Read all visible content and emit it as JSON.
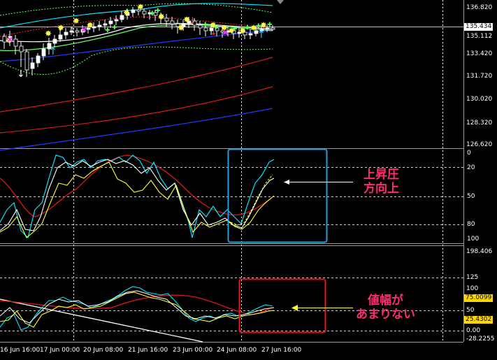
{
  "price_axis": {
    "ticks": [
      "136.820",
      "135.112",
      "133.420",
      "131.720",
      "130.020",
      "128.320",
      "126.620"
    ],
    "current": "135.434"
  },
  "osc1_axis": {
    "ticks": [
      "0",
      "20",
      "50",
      "80",
      "100"
    ]
  },
  "osc2_axis": {
    "ticks": [
      "198.406",
      "125",
      "100",
      "50",
      "0.00",
      "-28.2255"
    ],
    "box_upper": "75.0099",
    "box_lower": "25.4302"
  },
  "time_axis": [
    "16 Jun 16:00",
    "17 Jun 00:00",
    "20 Jun 08:00",
    "21 Jun 16:00",
    "23 Jun 00:00",
    "24 Jun 08:00",
    "27 Jun 16:00"
  ],
  "annotations": {
    "upper": [
      "上昇圧",
      "方向上"
    ],
    "lower": [
      "値幅が",
      "あまりない"
    ]
  },
  "colors": {
    "bg": "#000000",
    "grid": "#ffffff",
    "panel_border": "#aaaaaa",
    "upper_box": "#1fa0dc",
    "lower_box": "#e01818",
    "annotation": "#ff2d6e",
    "cyan": "#00e5ff",
    "yellow": "#ffff33",
    "red": "#d81a1a",
    "blue": "#1f3cff",
    "green": "#66ff66",
    "pink": "#ff33ff"
  }
}
